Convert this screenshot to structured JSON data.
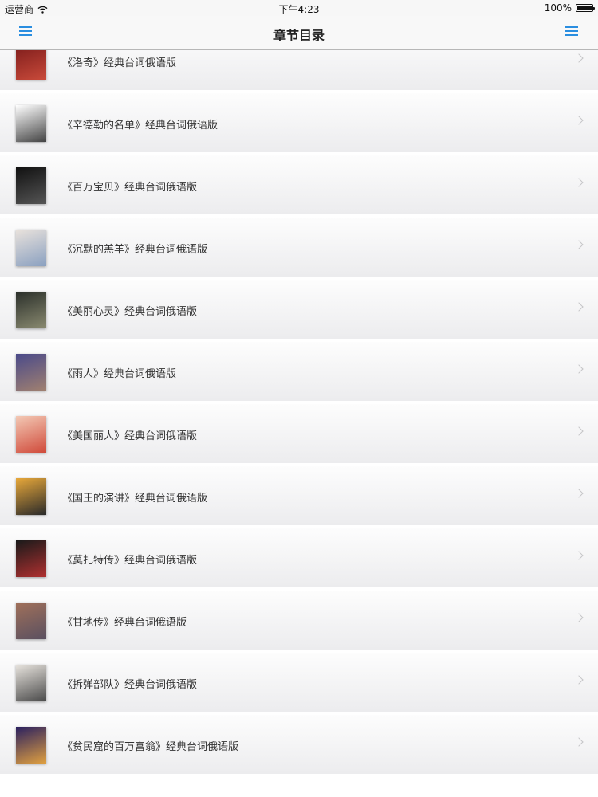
{
  "status_bar": {
    "carrier": "运营商",
    "time": "下午4:23",
    "battery": "100%"
  },
  "nav": {
    "title": "章节目录"
  },
  "chapters": [
    {
      "label": "《洛奇》经典台词俄语版",
      "poster": "movie-poster-icon",
      "colors": [
        "#7a1a1a",
        "#c94a3a"
      ]
    },
    {
      "label": "《辛德勒的名单》经典台词俄语版",
      "poster": "movie-poster-icon",
      "colors": [
        "#ffffff",
        "#444444"
      ]
    },
    {
      "label": "《百万宝贝》经典台词俄语版",
      "poster": "movie-poster-icon",
      "colors": [
        "#111111",
        "#555555"
      ]
    },
    {
      "label": "《沉默的羔羊》经典台词俄语版",
      "poster": "movie-poster-icon",
      "colors": [
        "#e9e2dc",
        "#8aa0c0"
      ]
    },
    {
      "label": "《美丽心灵》经典台词俄语版",
      "poster": "movie-poster-icon",
      "colors": [
        "#2a2f2a",
        "#8a8a70"
      ]
    },
    {
      "label": "《雨人》经典台词俄语版",
      "poster": "movie-poster-icon",
      "colors": [
        "#4a4a8a",
        "#a08070"
      ]
    },
    {
      "label": "《美国丽人》经典台词俄语版",
      "poster": "movie-poster-icon",
      "colors": [
        "#f3c9b5",
        "#d04a3a"
      ]
    },
    {
      "label": "《国王的演讲》经典台词俄语版",
      "poster": "movie-poster-icon",
      "colors": [
        "#e8a83a",
        "#2a2a2a"
      ]
    },
    {
      "label": "《莫扎特传》经典台词俄语版",
      "poster": "movie-poster-icon",
      "colors": [
        "#1a1a1a",
        "#b03030"
      ]
    },
    {
      "label": "《甘地传》经典台词俄语版",
      "poster": "movie-poster-icon",
      "colors": [
        "#a0705a",
        "#5a5060"
      ]
    },
    {
      "label": "《拆弹部队》经典台词俄语版",
      "poster": "movie-poster-icon",
      "colors": [
        "#e8e4de",
        "#4a4a4a"
      ]
    },
    {
      "label": "《贫民窟的百万富翁》经典台词俄语版",
      "poster": "movie-poster-icon",
      "colors": [
        "#2a2060",
        "#e0a040"
      ]
    }
  ],
  "colors": {
    "accent": "#2a8ee0",
    "chevron": "#c5c5c7"
  }
}
